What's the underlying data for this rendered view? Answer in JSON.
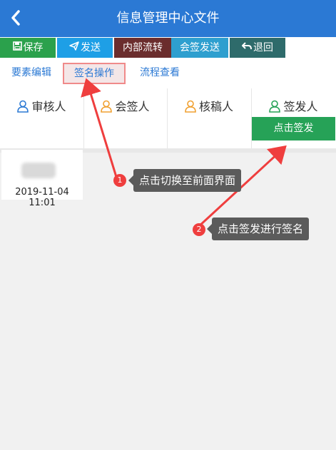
{
  "header": {
    "title": "信息管理中心文件"
  },
  "toolbar": {
    "save": "保存",
    "send": "发送",
    "internal": "内部流转",
    "countersign_send": "会签发送",
    "return": "退回"
  },
  "tabs": {
    "edit": "要素编辑",
    "sign": "签名操作",
    "flow": "流程查看"
  },
  "roles": [
    "审核人",
    "会签人",
    "核稿人",
    "签发人"
  ],
  "sign_button": "点击签发",
  "record": {
    "timestamp": "2019-11-04 11:01"
  },
  "annotations": [
    {
      "num": "1",
      "text": "点击切换至前面界面"
    },
    {
      "num": "2",
      "text": "点击签发进行签名"
    }
  ],
  "colors": {
    "header": "#2b79d4",
    "save": "#2ba14c",
    "send": "#1e9fe6",
    "internal": "#6b2d2d",
    "countersign": "#2e9fcf",
    "return": "#2e6b6b",
    "sign_button": "#26a257",
    "annotation_arrow": "#ef3e3e"
  }
}
